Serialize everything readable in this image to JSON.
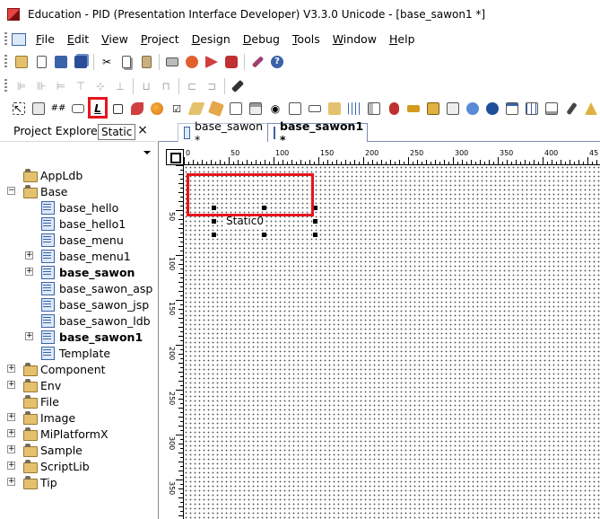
{
  "window": {
    "title": "Education - PID (Presentation Interface Developer) V3.3.0 Unicode - [base_sawon1 *]"
  },
  "menu": [
    {
      "label": "File",
      "mnemonic": "F",
      "rest": "ile"
    },
    {
      "label": "Edit",
      "mnemonic": "E",
      "rest": "dit"
    },
    {
      "label": "View",
      "mnemonic": "V",
      "rest": "iew"
    },
    {
      "label": "Project",
      "mnemonic": "P",
      "rest": "roject"
    },
    {
      "label": "Design",
      "mnemonic": "D",
      "rest": "esign"
    },
    {
      "label": "Debug",
      "mnemonic": "D",
      "rest": "ebug"
    },
    {
      "label": "Tools",
      "mnemonic": "T",
      "rest": "ools"
    },
    {
      "label": "Window",
      "mnemonic": "W",
      "rest": "indow"
    },
    {
      "label": "Help",
      "mnemonic": "H",
      "rest": "elp"
    }
  ],
  "toolbar1": [
    "open-folder-icon",
    "new-file-icon",
    "save-icon",
    "save-all-icon",
    "cut-icon",
    "copy-icon",
    "paste-icon",
    "print-icon",
    "build-icon",
    "run-icon",
    "debug-icon",
    "options-icon",
    "help-icon"
  ],
  "toolbar2": [
    "align-left-icon",
    "align-center-icon",
    "align-right-icon",
    "align-top-icon",
    "align-middle-icon",
    "align-bottom-icon",
    "same-width-icon",
    "same-height-icon",
    "same-size-icon",
    "space-horz-icon",
    "space-vert-icon",
    "pin-icon"
  ],
  "toolbar3": [
    "pointer-icon",
    "button-icon",
    "grid-icon",
    "shape-icon",
    "static-text-icon",
    "rect-icon",
    "image-icon",
    "combo-icon",
    "checkbox-icon",
    "edit-icon",
    "radio-icon",
    "tab-icon",
    "div-icon",
    "menu-icon",
    "spin-icon",
    "list-icon",
    "treeview-icon",
    "calendar-icon",
    "chart-icon",
    "activex-icon",
    "progress-icon",
    "sound-icon",
    "webbrowser-icon",
    "shockwave-icon",
    "msgbox-icon",
    "table-icon",
    "splitter-icon",
    "pen-icon",
    "graphic-icon"
  ],
  "project_explorer": {
    "title": "Project Explorer",
    "tooltip": "Static",
    "close": "×",
    "tree": [
      {
        "label": "AppLdb",
        "type": "folder",
        "level": 0,
        "expander": "",
        "bold": false
      },
      {
        "label": "Base",
        "type": "folder",
        "level": 0,
        "expander": "−",
        "bold": false
      },
      {
        "label": "base_hello",
        "type": "page",
        "level": 1,
        "expander": "",
        "bold": false
      },
      {
        "label": "base_hello1",
        "type": "page",
        "level": 1,
        "expander": "",
        "bold": false
      },
      {
        "label": "base_menu",
        "type": "page",
        "level": 1,
        "expander": "",
        "bold": false
      },
      {
        "label": "base_menu1",
        "type": "page",
        "level": 1,
        "expander": "+",
        "bold": false
      },
      {
        "label": "base_sawon",
        "type": "page",
        "level": 1,
        "expander": "+",
        "bold": true
      },
      {
        "label": "base_sawon_asp",
        "type": "page",
        "level": 1,
        "expander": "",
        "bold": false
      },
      {
        "label": "base_sawon_jsp",
        "type": "page",
        "level": 1,
        "expander": "",
        "bold": false
      },
      {
        "label": "base_sawon_ldb",
        "type": "page",
        "level": 1,
        "expander": "",
        "bold": false
      },
      {
        "label": "base_sawon1",
        "type": "page",
        "level": 1,
        "expander": "+",
        "bold": true
      },
      {
        "label": "Template",
        "type": "page",
        "level": 1,
        "expander": "",
        "bold": false
      },
      {
        "label": "Component",
        "type": "folder",
        "level": 0,
        "expander": "+",
        "bold": false
      },
      {
        "label": "Env",
        "type": "folder",
        "level": 0,
        "expander": "+",
        "bold": false
      },
      {
        "label": "File",
        "type": "folder",
        "level": 0,
        "expander": "",
        "bold": false
      },
      {
        "label": "Image",
        "type": "folder",
        "level": 0,
        "expander": "+",
        "bold": false
      },
      {
        "label": "MiPlatformX",
        "type": "folder",
        "level": 0,
        "expander": "+",
        "bold": false
      },
      {
        "label": "Sample",
        "type": "folder",
        "level": 0,
        "expander": "+",
        "bold": false
      },
      {
        "label": "ScriptLib",
        "type": "folder",
        "level": 0,
        "expander": "+",
        "bold": false
      },
      {
        "label": "Tip",
        "type": "folder",
        "level": 0,
        "expander": "+",
        "bold": false
      }
    ]
  },
  "editor": {
    "tabs": [
      {
        "label": "base_sawon *",
        "active": false
      },
      {
        "label": "base_sawon1 *",
        "active": true
      }
    ],
    "hruler_labels": [
      "0",
      "50",
      "100",
      "150",
      "200",
      "250",
      "300",
      "350",
      "400",
      "45"
    ],
    "vruler_labels": [
      "50",
      "100",
      "150",
      "200",
      "250",
      "300",
      "350"
    ],
    "static_label": "Static0"
  },
  "colors": {
    "highlight": "#e8141c",
    "selection": "#000000"
  }
}
